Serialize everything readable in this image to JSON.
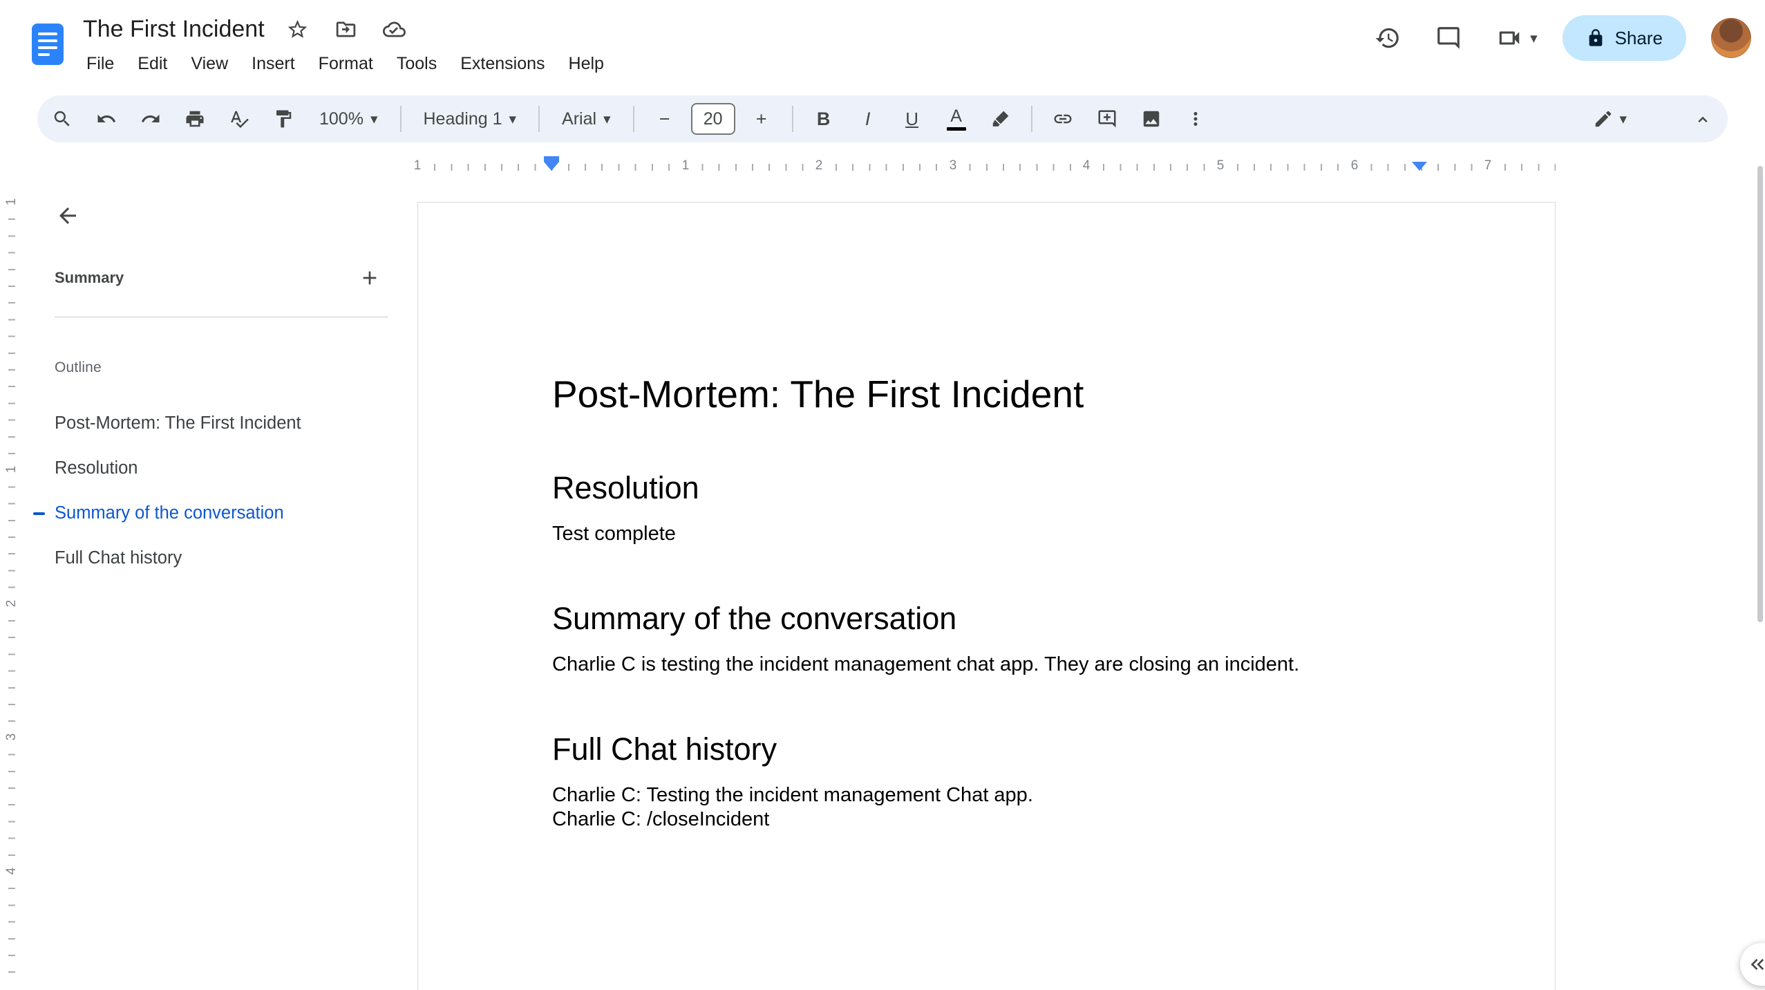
{
  "header": {
    "doc_title": "The First Incident",
    "menu": [
      "File",
      "Edit",
      "View",
      "Insert",
      "Format",
      "Tools",
      "Extensions",
      "Help"
    ],
    "share_label": "Share"
  },
  "toolbar": {
    "zoom": "100%",
    "styles": "Heading 1",
    "font": "Arial",
    "font_size": "20"
  },
  "icons": {
    "caret": "▾",
    "minus": "−",
    "bold": "B",
    "italic": "I",
    "underline": "U",
    "text_color": "A"
  },
  "ruler": {
    "h_numbers": [
      "1",
      "1",
      "2",
      "3",
      "4",
      "5",
      "6",
      "7"
    ],
    "v_numbers": [
      "1",
      "1",
      "2",
      "3",
      "4"
    ]
  },
  "sidebar": {
    "summary_label": "Summary",
    "outline_label": "Outline",
    "items": [
      {
        "label": "Post-Mortem: The First Incident",
        "active": false
      },
      {
        "label": "Resolution",
        "active": false
      },
      {
        "label": "Summary of the conversation",
        "active": true
      },
      {
        "label": "Full Chat history",
        "active": false
      }
    ]
  },
  "document": {
    "title": "Post-Mortem: The First Incident",
    "sections": [
      {
        "heading": "Resolution",
        "paragraphs": [
          "Test complete"
        ]
      },
      {
        "heading": "Summary of the conversation",
        "paragraphs": [
          "Charlie C is testing the incident management chat app. They are closing an incident."
        ]
      },
      {
        "heading": "Full Chat history",
        "paragraphs": [
          "Charlie C: Testing the incident management Chat app.",
          "Charlie C: /closeIncident"
        ]
      }
    ]
  },
  "colors": {
    "accent_blue": "#0b57d0",
    "share_bg": "#c2e7ff",
    "share_text": "#001d35",
    "toolbar_bg": "#edf2fa",
    "docs_icon_blue": "#2b83fb",
    "ruler_marker_blue": "#4285f4"
  }
}
